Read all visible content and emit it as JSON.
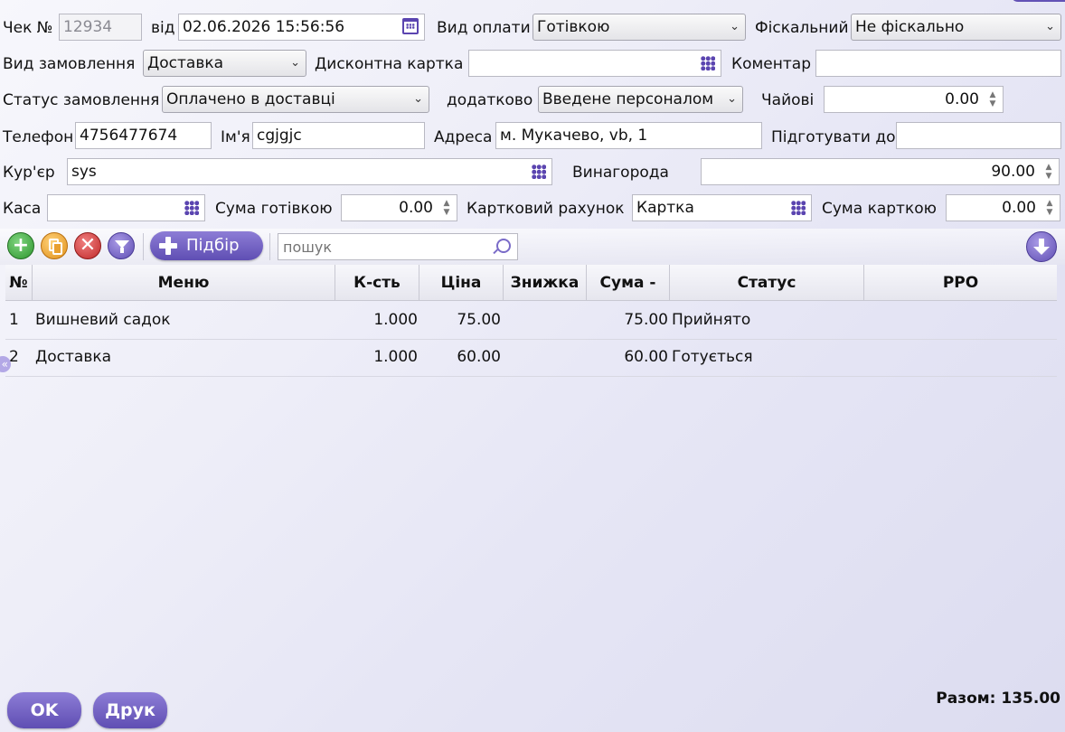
{
  "header": {
    "check_no_label": "Чек №",
    "check_no": "12934",
    "date_label": "від",
    "date": "02.06.2026 15:56:56",
    "payment_type_label": "Вид оплати",
    "payment_type": "Готівкою",
    "fiscal_label": "Фіскальний",
    "fiscal": "Не фіскально",
    "order_type_label": "Вид замовлення",
    "order_type": "Доставка",
    "discount_card_label": "Дисконтна картка",
    "discount_card": "",
    "comment_label": "Коментар",
    "comment": "",
    "order_status_label": "Статус замовлення",
    "order_status": "Оплачено в доставці",
    "additional_label": "додатково",
    "additional": "Введене персоналом",
    "tips_label": "Чайові",
    "tips": "0.00",
    "phone_label": "Телефон",
    "phone": "4756477674",
    "name_label": "Ім'я",
    "name": "cgjgjc",
    "address_label": "Адреса",
    "address": "м. Мукачево, vb, 1",
    "prepare_by_label": "Підготувати до",
    "prepare_by": "",
    "courier_label": "Кур'єр",
    "courier": "sys",
    "reward_label": "Винагорода",
    "reward": "90.00",
    "cashbox_label": "Каса",
    "cashbox": "",
    "cash_sum_label": "Сума готівкою",
    "cash_sum": "0.00",
    "card_account_label": "Картковий рахунок",
    "card_account": "Картка",
    "card_sum_label": "Сума карткою",
    "card_sum": "0.00"
  },
  "toolbar": {
    "pick_label": "Підбір",
    "search_placeholder": "пошук",
    "icons": [
      "add-icon",
      "copy-icon",
      "delete-icon",
      "filter-icon",
      "pick-icon",
      "search-icon",
      "download-icon"
    ]
  },
  "table": {
    "columns": [
      "№",
      "Меню",
      "К-сть",
      "Ціна",
      "Знижка",
      "Сума -",
      "Статус",
      "РРО"
    ],
    "rows": [
      {
        "no": "1",
        "menu": "Вишневий садок",
        "qty": "1.000",
        "price": "75.00",
        "discount": "",
        "sum": "75.00",
        "status": "Прийнято",
        "rro": ""
      },
      {
        "no": "2",
        "menu": "Доставка",
        "qty": "1.000",
        "price": "60.00",
        "discount": "",
        "sum": "60.00",
        "status": "Готується",
        "rro": ""
      }
    ]
  },
  "collapse_glyph": "«",
  "footer": {
    "ok_label": "OK",
    "print_label": "Друк",
    "total_label": "Разом: 135.00"
  },
  "colors": {
    "accent": "#6a59c0",
    "add_green": "#3aa53a",
    "copy_orange": "#f0a020",
    "delete_red": "#cc3333"
  }
}
